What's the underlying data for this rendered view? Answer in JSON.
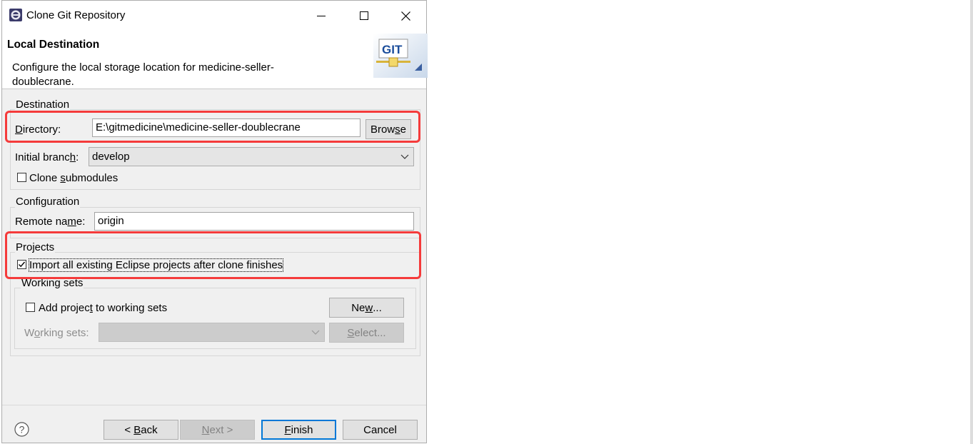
{
  "window": {
    "title": "Clone Git Repository"
  },
  "banner": {
    "title": "Local Destination",
    "description": "Configure the local storage location for medicine-seller-doublecrane.",
    "logo_text": "GIT"
  },
  "destination": {
    "group_label": "Destination",
    "directory_label_pre": "",
    "directory_label_mn": "D",
    "directory_label_post": "irectory:",
    "directory_value": "E:\\gitmedicine\\medicine-seller-doublecrane",
    "browse_pre": "Brow",
    "browse_mn": "s",
    "browse_post": "e",
    "initial_branch_pre": "Initial branc",
    "initial_branch_mn": "h",
    "initial_branch_post": ":",
    "initial_branch_value": "develop",
    "clone_submodules_pre": "Clone ",
    "clone_submodules_mn": "s",
    "clone_submodules_post": "ubmodules",
    "clone_submodules_checked": false
  },
  "configuration": {
    "group_label": "Configuration",
    "remote_name_pre": "Remote na",
    "remote_name_mn": "m",
    "remote_name_post": "e:",
    "remote_name_value": "origin"
  },
  "projects": {
    "group_label": "Projects",
    "import_label": "Import all existing Eclipse projects after clone finishes",
    "import_checked": true
  },
  "working_sets": {
    "group_label": "Working sets",
    "add_pre": "Add projec",
    "add_mn": "t",
    "add_post": " to working sets",
    "add_checked": false,
    "new_pre": "Ne",
    "new_mn": "w",
    "new_post": "...",
    "sets_pre": "W",
    "sets_mn": "o",
    "sets_post": "rking sets:",
    "sets_value": "",
    "select_pre": "",
    "select_mn": "S",
    "select_post": "elect..."
  },
  "footer": {
    "back_pre": "< ",
    "back_mn": "B",
    "back_post": "ack",
    "next_pre": "",
    "next_mn": "N",
    "next_post": "ext >",
    "finish_pre": "",
    "finish_mn": "F",
    "finish_post": "inish",
    "cancel": "Cancel"
  },
  "colors": {
    "highlight_border": "#f53b3b",
    "default_button_border": "#0078d7",
    "dialog_bg": "#f0f0f0"
  },
  "icons": {
    "app": "eclipse-icon",
    "help": "help-icon",
    "minimize": "minimize-icon",
    "maximize": "maximize-icon",
    "close": "close-icon",
    "dropdown": "chevron-down-icon",
    "check": "checkmark-icon"
  }
}
